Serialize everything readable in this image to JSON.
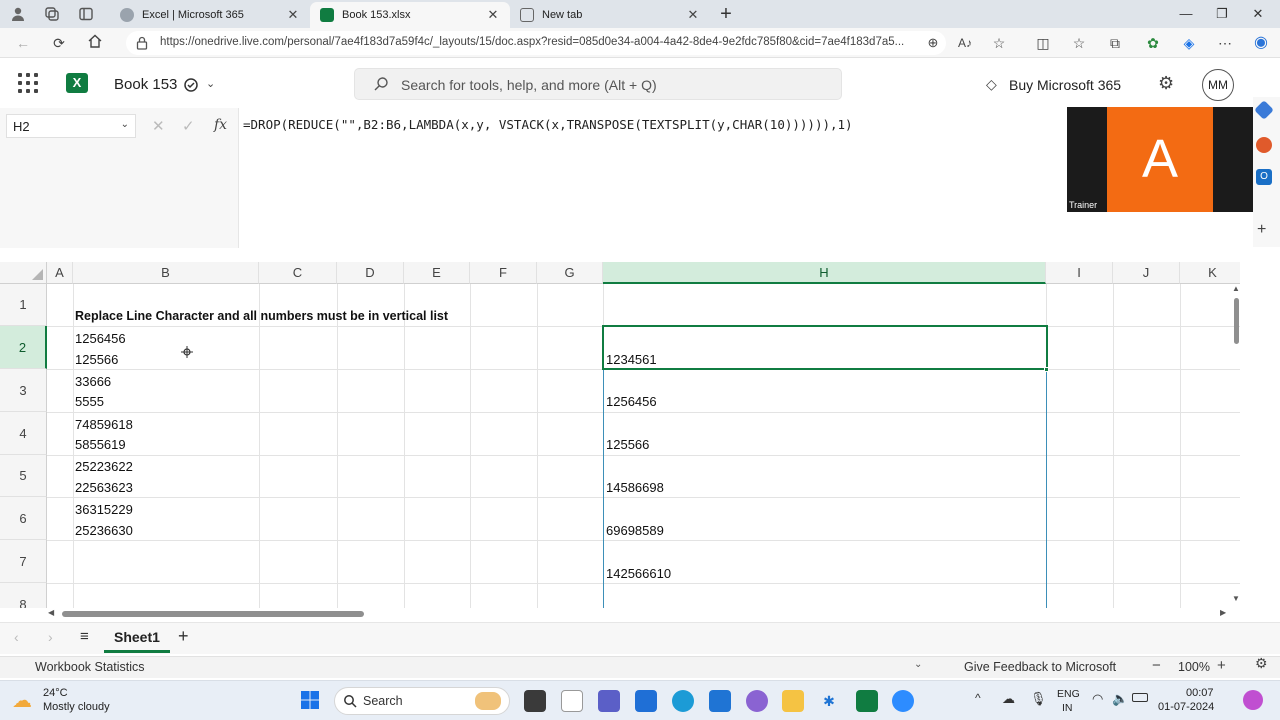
{
  "browser": {
    "tabs": [
      {
        "label": "Excel | Microsoft 365",
        "active": false
      },
      {
        "label": "Book 153.xlsx",
        "active": true
      },
      {
        "label": "New tab",
        "active": false
      }
    ],
    "url": "https://onedrive.live.com/personal/7ae4f183d7a59f4c/_layouts/15/doc.aspx?resid=085d0e34-a004-4a42-8de4-9e2fdc785f80&cid=7ae4f183d7a5..."
  },
  "app": {
    "title": "Book 153",
    "search_placeholder": "Search for tools, help, and more (Alt + Q)",
    "buy_label": "Buy Microsoft 365",
    "avatar_initials": "MM",
    "accent": "#107c41"
  },
  "formula_bar": {
    "name_box": "H2",
    "fx_label": "fx",
    "formula": "=DROP(REDUCE(\"\",B2:B6,LAMBDA(x,y, VSTACK(x,TRANSPOSE(TEXTSPLIT(y,CHAR(10)))))),1)"
  },
  "trainer": {
    "letter": "A",
    "name": "Trainer"
  },
  "grid": {
    "columns": [
      "A",
      "B",
      "C",
      "D",
      "E",
      "F",
      "G",
      "H",
      "I",
      "J",
      "K"
    ],
    "selected_column": "H",
    "rows": [
      "1",
      "2",
      "3",
      "4",
      "5",
      "6",
      "7",
      "8"
    ],
    "selected_row": "2",
    "b1": "Replace Line Character and all numbers must be in vertical list",
    "b_cells": [
      [
        "1256456",
        "125566"
      ],
      [
        "33666",
        "5555"
      ],
      [
        "74859618",
        "5855619"
      ],
      [
        "25223622",
        "22563623"
      ],
      [
        "36315229",
        "25236630"
      ]
    ],
    "h_cells": [
      "1234561",
      "1256456",
      "125566",
      "14586698",
      "69698589",
      "142566610"
    ]
  },
  "sheets": {
    "active": "Sheet1"
  },
  "status": {
    "left": "Workbook Statistics",
    "feedback": "Give Feedback to Microsoft",
    "zoom": "100%"
  },
  "taskbar": {
    "temperature": "24°C",
    "weather": "Mostly cloudy",
    "search_label": "Search",
    "lang_line1": "ENG",
    "lang_line2": "IN",
    "time": "00:07",
    "date": "01-07-2024"
  }
}
